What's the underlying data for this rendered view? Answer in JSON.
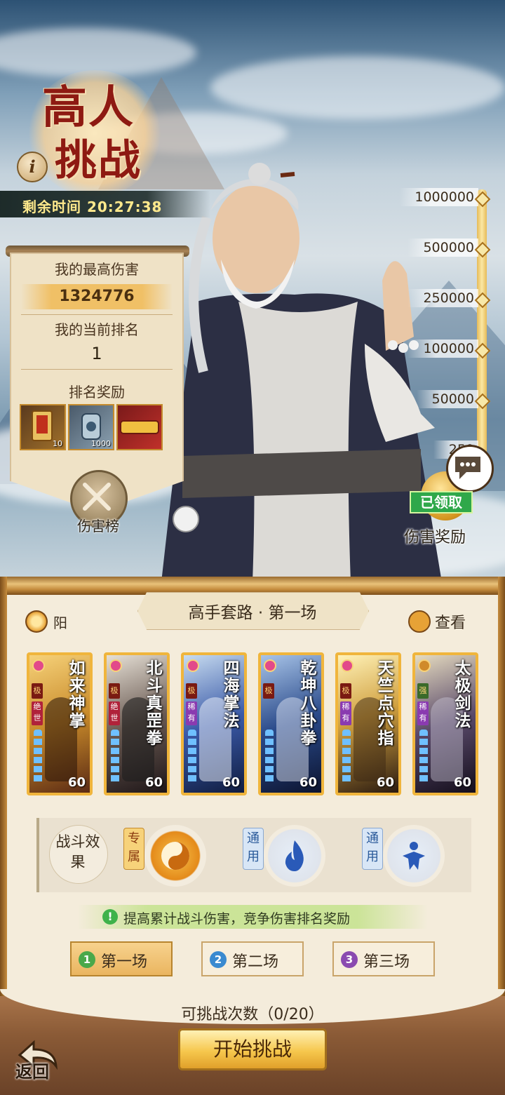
{
  "event": {
    "title_line1": "高人",
    "title_line2": "挑战",
    "info_icon": "i",
    "countdown": "剩余时间 20:27:38"
  },
  "stats": {
    "best_damage_label": "我的最高伤害",
    "best_damage_value": "1324776",
    "rank_label": "我的当前排名",
    "rank_value": "1",
    "rank_reward_label": "排名奖励",
    "rewards": [
      {
        "icon": "scroll-item-icon",
        "count": "10"
      },
      {
        "icon": "jade-token-icon",
        "count": "1000"
      },
      {
        "icon": "title-badge-icon",
        "count": ""
      }
    ]
  },
  "damage_rank_label": "伤害榜",
  "damage_scale": {
    "ticks": [
      "1000000",
      "500000",
      "250000",
      "100000",
      "50000",
      "250"
    ],
    "claimed_label": "已领取",
    "reward_label": "伤害奖励"
  },
  "stage_panel": {
    "subtitle": "高手套路 · 第一场",
    "element_label": "阳",
    "view_label": "查看",
    "cards": [
      {
        "name": "如来神掌",
        "grade": "极",
        "rarity": "绝世",
        "level": "60",
        "bg": "#c88a2a",
        "rarity_color": "#b0223a"
      },
      {
        "name": "北斗真罡拳",
        "grade": "极",
        "rarity": "绝世",
        "level": "60",
        "bg": "#6a5a52",
        "rarity_color": "#b0223a"
      },
      {
        "name": "四海掌法",
        "grade": "极",
        "rarity": "稀有",
        "level": "60",
        "bg": "#3a5aa8",
        "rarity_color": "#8a3ab0"
      },
      {
        "name": "乾坤八卦拳",
        "grade": "极",
        "rarity": "",
        "level": "60",
        "bg": "#2a4a8a",
        "rarity_color": "#8a3ab0"
      },
      {
        "name": "天竺点穴指",
        "grade": "极",
        "rarity": "稀有",
        "level": "60",
        "bg": "#d0a040",
        "rarity_color": "#8a3ab0"
      },
      {
        "name": "太极剑法",
        "grade": "强",
        "rarity": "稀有",
        "level": "60",
        "bg": "#5a4a6a",
        "rarity_color": "#8a3ab0"
      }
    ],
    "effects": {
      "label": "战斗效果",
      "exclusive_tag": "专属",
      "general_tag_1": "通用",
      "general_tag_2": "通用"
    },
    "hint": "提高累计战斗伤害，竞争伤害排名奖励",
    "stages": [
      {
        "num": "1",
        "label": "第一场",
        "color": "#4aa84a"
      },
      {
        "num": "2",
        "label": "第二场",
        "color": "#3a8ad0"
      },
      {
        "num": "3",
        "label": "第三场",
        "color": "#8a4ab0"
      }
    ],
    "attempts": "可挑战次数（0/20）",
    "start_button": "开始挑战",
    "back_label": "返回"
  }
}
